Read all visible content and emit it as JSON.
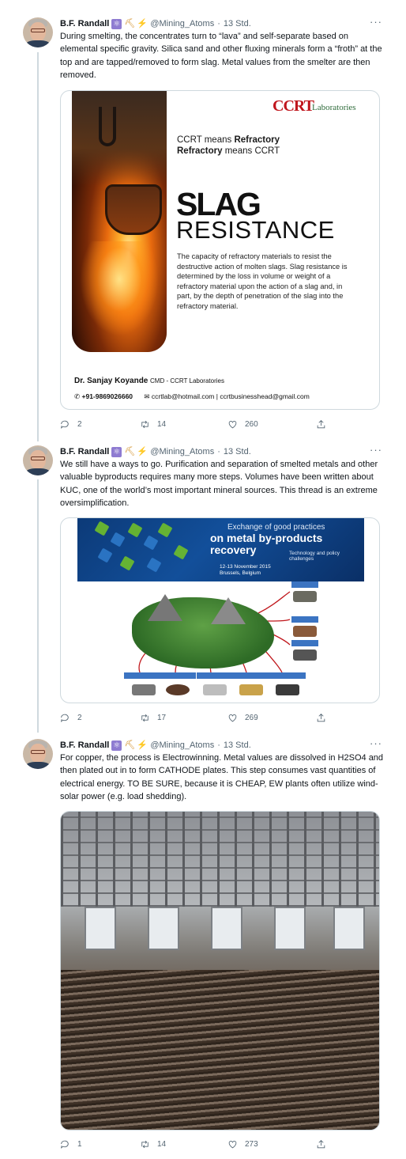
{
  "tweets": [
    {
      "author": {
        "name": "B.F. Randall",
        "handle": "@Mining_Atoms",
        "time": "13 Std.",
        "emojis": [
          "⚛",
          "⛏",
          "⚡"
        ]
      },
      "text": "During smelting, the concentrates turn to “lava” and self-separate based on elemental specific gravity. Silica sand and other fluxing minerals form a “froth” at the top and are tapped/removed to form slag. Metal values from the smelter are then removed.",
      "media": {
        "logo": "CCRT",
        "logo_sub": "Laboratories",
        "tagline_1a": "CCRT means ",
        "tagline_1b": "Refractory",
        "tagline_2a": "Refractory",
        "tagline_2b": " means CCRT",
        "title_1": "SLAG",
        "title_2": "RESISTANCE",
        "description": "The capacity of refractory materials to resist the destructive action of molten slags. Slag resistance is determined by the loss in volume or weight of a refractory material upon the action of a slag and, in part, by the depth of penetration of the slag into the refractory material.",
        "person": "Dr. Sanjay Koyande",
        "person_role": "CMD - CCRT Laboratories",
        "phone": "+91-9869026660",
        "emails": "ccrtlab@hotmail.com | ccrtbusinesshead@gmail.com"
      },
      "replies": "2",
      "retweets": "14",
      "likes": "260"
    },
    {
      "author": {
        "name": "B.F. Randall",
        "handle": "@Mining_Atoms",
        "time": "13 Std.",
        "emojis": [
          "⚛",
          "⛏",
          "⚡"
        ]
      },
      "text": "We still have a ways to go. Purification and separation of smelted metals and other valuable byproducts requires many more steps. Volumes have been written about KUC, one of the world’s most important mineral sources. This thread is an extreme oversimplification.",
      "media": {
        "banner_top": "Exchange of good practices",
        "banner_main_1": "on metal by-products",
        "banner_main_2": "recovery",
        "banner_sub": "Technology and policy challenges",
        "banner_date_1": "12-13 November 2015",
        "banner_date_2": "Brussels, Belgium"
      },
      "replies": "2",
      "retweets": "17",
      "likes": "269"
    },
    {
      "author": {
        "name": "B.F. Randall",
        "handle": "@Mining_Atoms",
        "time": "13 Std.",
        "emojis": [
          "⚛",
          "⛏",
          "⚡"
        ]
      },
      "text": "For copper, the process is Electrowinning. Metal values are dissolved in H2SO4 and then plated out in to form CATHODE plates. This step consumes vast quantities of electrical energy. TO BE SURE, because it is CHEAP, EW plants often utilize wind-solar power (e.g. load shedding).",
      "media": {},
      "replies": "1",
      "retweets": "14",
      "likes": "273"
    }
  ],
  "icons": {
    "reply": "reply-icon",
    "retweet": "retweet-icon",
    "like": "heart-icon",
    "share": "share-icon",
    "more": "more-icon"
  },
  "colors": {
    "text": "#0f1419",
    "secondary": "#536471",
    "border": "#cfd9de",
    "ccrt_red": "#c0151c"
  }
}
